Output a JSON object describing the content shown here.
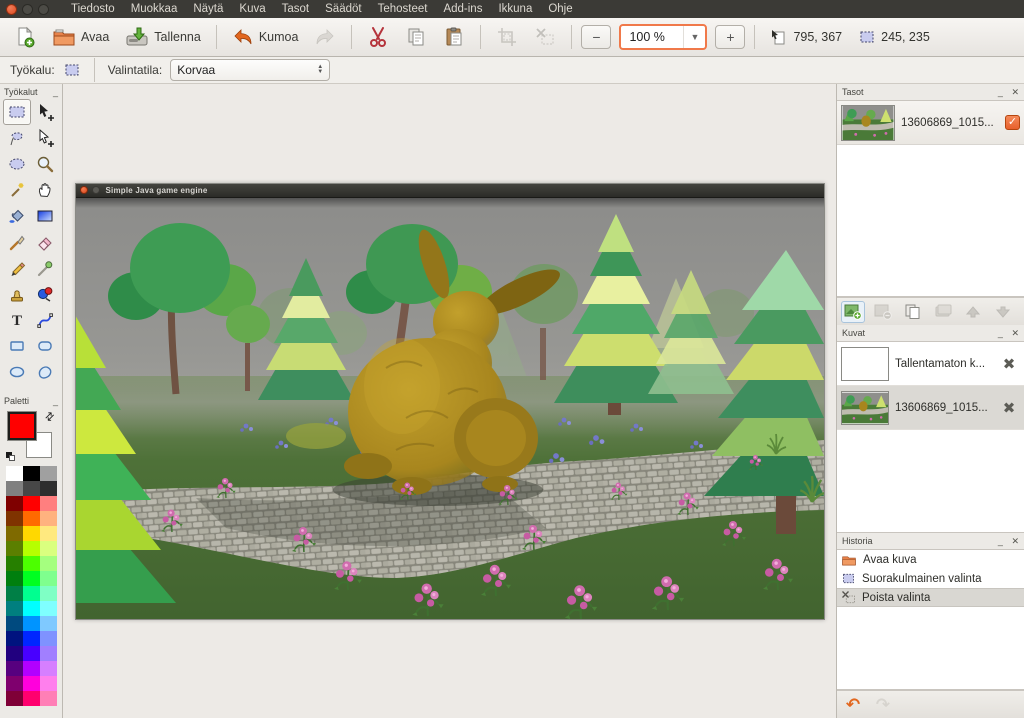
{
  "window": {
    "controls": [
      "close",
      "minimize",
      "maximize"
    ]
  },
  "menubar": {
    "items": [
      "Tiedosto",
      "Muokkaa",
      "Näytä",
      "Kuva",
      "Tasot",
      "Säädöt",
      "Tehosteet",
      "Add-ins",
      "Ikkuna",
      "Ohje"
    ]
  },
  "toolbar": {
    "open_label": "Avaa",
    "save_label": "Tallenna",
    "undo_label": "Kumoa",
    "zoom_value": "100 %",
    "image_size_indicator": "795, 367",
    "selection_size_indicator": "245, 235",
    "icons": [
      "new-document-icon",
      "open-folder-icon",
      "save-icon",
      "undo-icon",
      "redo-icon",
      "cut-icon",
      "copy-icon",
      "paste-icon",
      "crop-icon",
      "deselect-icon",
      "zoom-out-icon",
      "zoom-in-icon",
      "image-size-icon",
      "selection-size-icon"
    ]
  },
  "tool_options": {
    "tool_label": "Työkalu:",
    "selection_mode_label": "Valintatila:",
    "selection_mode_value": "Korvaa"
  },
  "left_dock": {
    "tools_panel": {
      "title": "Työkalut",
      "tools": [
        {
          "name": "rectangle-select",
          "active": true
        },
        {
          "name": "move-selection"
        },
        {
          "name": "lasso-select"
        },
        {
          "name": "move-selected"
        },
        {
          "name": "ellipse-select"
        },
        {
          "name": "zoom"
        },
        {
          "name": "magic-wand"
        },
        {
          "name": "pan"
        },
        {
          "name": "paint-bucket"
        },
        {
          "name": "gradient"
        },
        {
          "name": "paintbrush"
        },
        {
          "name": "eraser"
        },
        {
          "name": "pencil"
        },
        {
          "name": "color-picker"
        },
        {
          "name": "clone-stamp"
        },
        {
          "name": "recolor"
        },
        {
          "name": "text"
        },
        {
          "name": "line-curve"
        },
        {
          "name": "rectangle"
        },
        {
          "name": "rounded-rectangle"
        },
        {
          "name": "ellipse"
        },
        {
          "name": "freeform-shape"
        }
      ]
    },
    "palette_panel": {
      "title": "Paletti",
      "primary_color": "#FF0000",
      "secondary_color": "#FFFFFF",
      "colors": [
        "#FFFFFF",
        "#000000",
        "#A0A0A0",
        "#808080",
        "#474747",
        "#2E2E2E",
        "#7F0000",
        "#FF0000",
        "#FF7F7F",
        "#7F3300",
        "#FF6A00",
        "#FFB27F",
        "#7F6A00",
        "#FFD800",
        "#FFE97F",
        "#5B7F00",
        "#B6FF00",
        "#DAFF7F",
        "#267F00",
        "#4CFF00",
        "#A5FF7F",
        "#007F0E",
        "#00FF21",
        "#7FFF8E",
        "#007F46",
        "#00FF90",
        "#7FFFC5",
        "#007F7F",
        "#00FFFF",
        "#7FFFFF",
        "#004A7F",
        "#0094FF",
        "#7FC9FF",
        "#00137F",
        "#0026FF",
        "#7F92FF",
        "#21007F",
        "#4800FF",
        "#A17FFF",
        "#57007F",
        "#B200FF",
        "#D67FFF",
        "#7F006E",
        "#FF00DC",
        "#FF7FED",
        "#7F0037",
        "#FF006E",
        "#FF7FB6"
      ]
    }
  },
  "canvas": {
    "image_window": {
      "title": "Simple Java game engine"
    }
  },
  "right_dock": {
    "layers_panel": {
      "title": "Tasot",
      "layers": [
        {
          "name": "13606869_1015...",
          "visible": true
        }
      ],
      "buttons": [
        "add-layer",
        "remove-layer",
        "duplicate-layer",
        "merge-layer-down",
        "move-layer-up",
        "move-layer-down"
      ]
    },
    "images_panel": {
      "title": "Kuvat",
      "images": [
        {
          "name": "Tallentamaton k...",
          "selected": false
        },
        {
          "name": "13606869_1015...",
          "selected": true
        }
      ]
    },
    "history_panel": {
      "title": "Historia",
      "items": [
        {
          "label": "Avaa kuva",
          "icon": "folder-icon",
          "selected": false
        },
        {
          "label": "Suorakulmainen valinta",
          "icon": "rectangle-select-icon",
          "selected": false
        },
        {
          "label": "Poista valinta",
          "icon": "deselect-icon",
          "selected": true
        }
      ]
    }
  },
  "colors": {
    "accent_orange": "#F0794A",
    "ubuntu_orange": "#E95420",
    "menubar_bg": "#3B3A36",
    "canvas_bg": "#EDEAE6"
  }
}
